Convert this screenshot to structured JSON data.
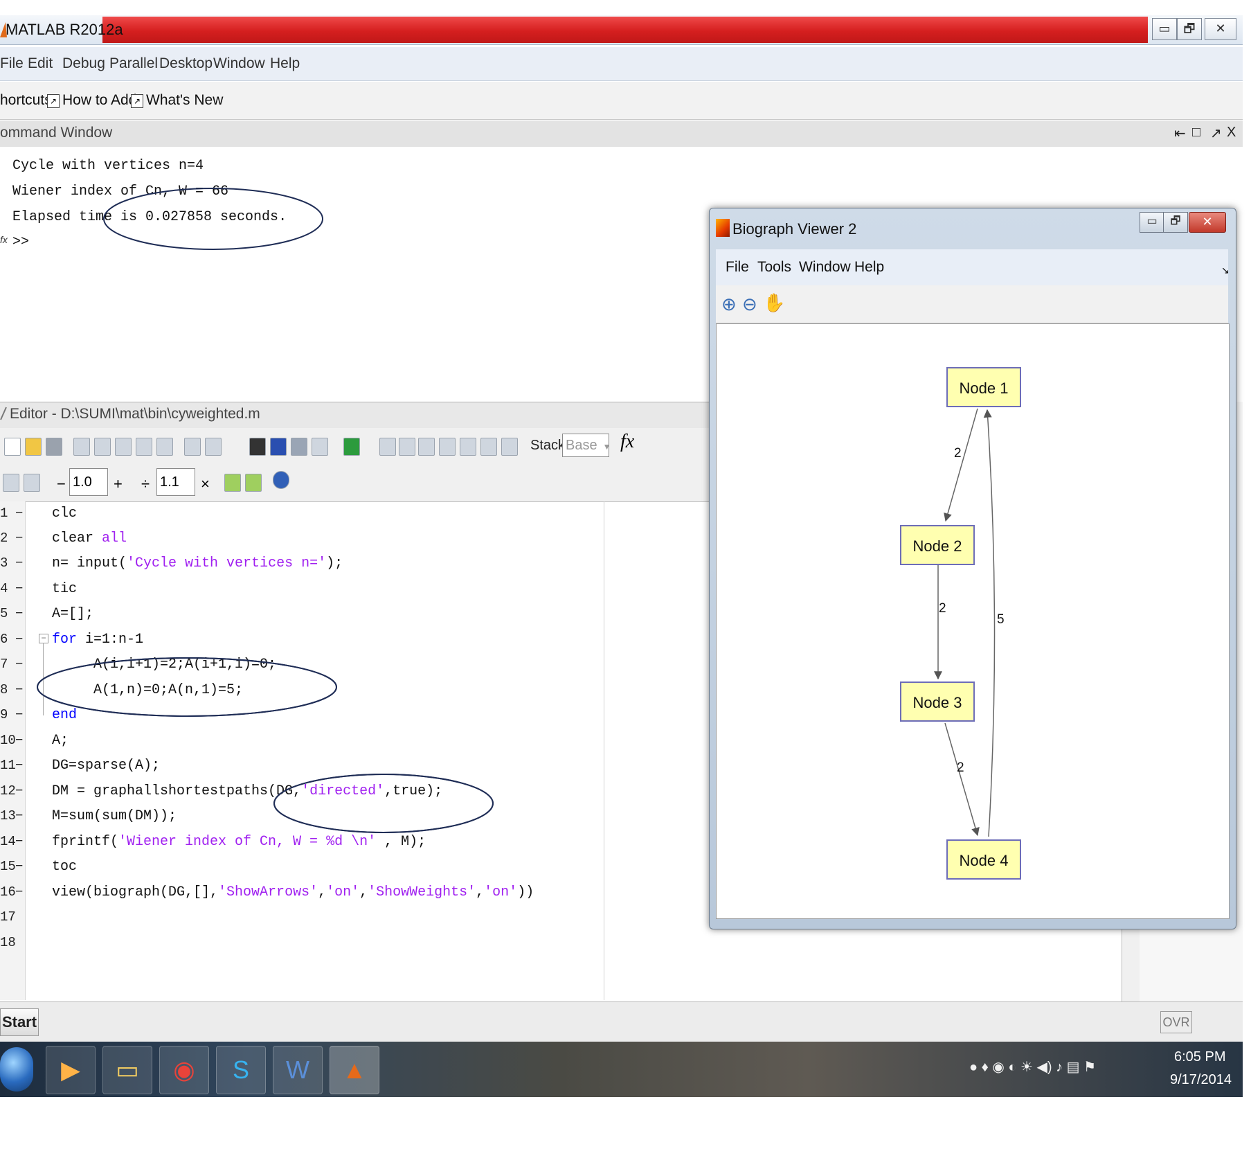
{
  "window": {
    "title": "MATLAB  R2012a",
    "controls": {
      "minimize": "▭",
      "maximize": "🗗",
      "close": "✕"
    }
  },
  "menu": [
    "File",
    "Edit",
    "Debug",
    "Parallel",
    "Desktop",
    "Window",
    "Help"
  ],
  "shortcuts": {
    "label": "hortcuts",
    "how_to_add": "How to Add",
    "whats_new": "What's New"
  },
  "command_window": {
    "title": "ommand Window",
    "lines": [
      "Cycle with vertices n=4",
      "Wiener index of Cn, W = 66",
      "Elapsed time is 0.027858 seconds.",
      ">>"
    ],
    "header_controls": [
      "⇤",
      "□",
      "↗",
      "X"
    ],
    "fx_marker": "fx"
  },
  "editor": {
    "title": "Editor - D:\\SUMI\\mat\\bin\\cyweighted.m",
    "stack_label": "Stack:",
    "stack_value": "Base",
    "fx": "fx",
    "cell_minus": "−",
    "cell_value1": "1.0",
    "cell_plus": "+",
    "cell_divide": "÷",
    "cell_value2": "1.1",
    "cell_times": "×",
    "line_numbers": [
      "1",
      "2",
      "3",
      "4",
      "5",
      "6",
      "7",
      "8",
      "9",
      "10",
      "11",
      "12",
      "13",
      "14",
      "15",
      "16",
      "17",
      "18"
    ],
    "lines": [
      {
        "code": "clc"
      },
      {
        "pre": "clear ",
        "str": "all"
      },
      {
        "pre": "n= input(",
        "str": "'Cycle with vertices n='",
        "post": ");"
      },
      {
        "code": "tic"
      },
      {
        "code": "A=[];"
      },
      {
        "kw": "for",
        "post": " i=1:n-1"
      },
      {
        "code": "     A(i,i+1)=2;A(i+1,i)=0;"
      },
      {
        "code": "     A(1,n)=0;A(n,1)=5;"
      },
      {
        "kw": "end"
      },
      {
        "code": "A;"
      },
      {
        "code": "DG=sparse(A);"
      },
      {
        "pre": "DM = graphallshortestpaths(DG,",
        "str": "'directed'",
        "post": ",true);"
      },
      {
        "code": "M=sum(sum(DM));"
      },
      {
        "pre": "fprintf(",
        "str": "'Wiener index of Cn, W = %d \\n'",
        "post": " , M);"
      },
      {
        "code": "toc"
      },
      {
        "pre": "view(biograph(DG,[],",
        "str": "'ShowArrows'",
        "mid1": ",",
        "str2": "'on'",
        "mid2": ",",
        "str3": "'ShowWeights'",
        "mid3": ",",
        "str4": "'on'",
        "post": "))"
      }
    ]
  },
  "status": {
    "start": "Start",
    "ovr": "OVR"
  },
  "taskbar": {
    "time": "6:05 PM",
    "date": "9/17/2014",
    "apps": [
      "start-orb",
      "media-player",
      "file-explorer",
      "chrome",
      "skype",
      "word",
      "matlab"
    ]
  },
  "biograph": {
    "title": "Biograph Viewer 2",
    "menu": [
      "File",
      "Tools",
      "Window",
      "Help"
    ],
    "tools": [
      "zoom-in",
      "zoom-out",
      "pan"
    ],
    "nodes": [
      "Node 1",
      "Node 2",
      "Node 3",
      "Node 4"
    ],
    "edges": [
      {
        "from": "Node 1",
        "to": "Node 2",
        "weight": "2"
      },
      {
        "from": "Node 2",
        "to": "Node 3",
        "weight": "2"
      },
      {
        "from": "Node 3",
        "to": "Node 4",
        "weight": "2"
      },
      {
        "from": "Node 4",
        "to": "Node 1",
        "weight": "5"
      }
    ]
  },
  "colors": {
    "title_red": "#d51f1f",
    "keyword": "#0000ff",
    "string": "#a020f0",
    "node_fill": "#ffffb0",
    "node_border": "#6d6db8"
  }
}
